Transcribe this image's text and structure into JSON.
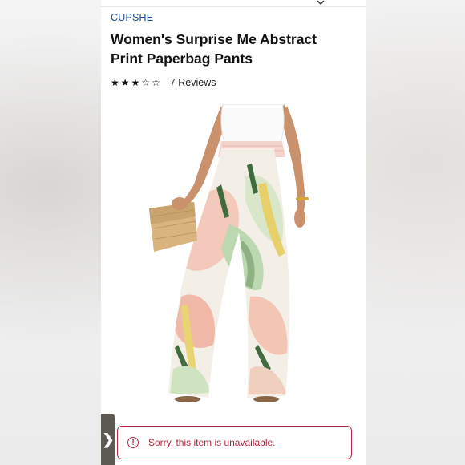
{
  "product": {
    "brand": "CUPSHE",
    "title": "Women's Surprise Me Abstract Print Paperbag Pants",
    "rating": {
      "stars": 3,
      "max": 5,
      "filled_char": "★",
      "empty_char": "☆",
      "reviews_label": "7 Reviews"
    },
    "image_alt_icon": "product-photo"
  },
  "alert": {
    "icon": "!",
    "message": "Sorry, this item is unavailable."
  },
  "side_tab": {
    "icon": "❯"
  },
  "colors": {
    "brand": "#1a4c9a",
    "alert": "#b3283e",
    "tab": "#5d5a52"
  }
}
